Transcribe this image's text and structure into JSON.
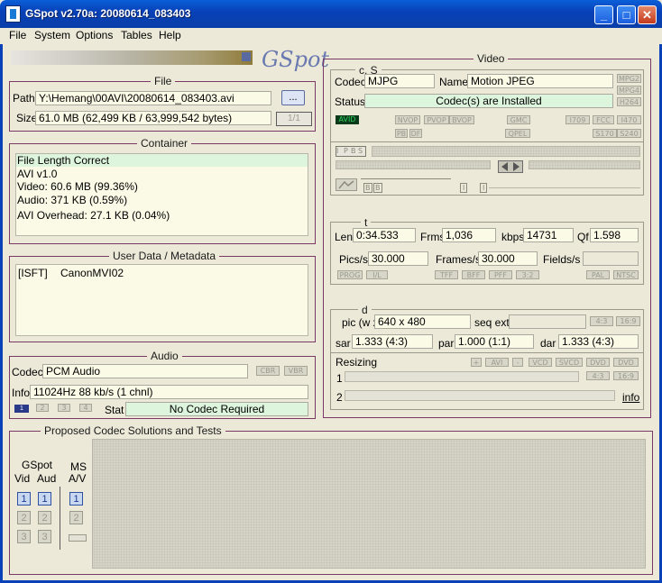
{
  "window": {
    "title": "GSpot v2.70a: 20080614_083403"
  },
  "menu": [
    "File",
    "System",
    "Options",
    "Tables",
    "Help"
  ],
  "logo_text": "GSpot",
  "file": {
    "title": "File",
    "path_label": "Path",
    "path_value": "Y:\\Hemang\\00AVI\\20080614_083403.avi",
    "browse_label": "...",
    "size_label": "Size",
    "size_value": "61.0 MB (62,499 KB / 63,999,542 bytes)",
    "page_counter": "1/1"
  },
  "container": {
    "title": "Container",
    "lines": [
      "File Length Correct",
      "AVI v1.0",
      "Video: 60.6 MB (99.36%)",
      "Audio: 371 KB (0.59%)",
      "AVI Overhead: 27.1 KB (0.04%)"
    ]
  },
  "metadata": {
    "title": "User Data / Metadata",
    "key": "[ISFT]",
    "value": "CanonMVI02"
  },
  "audio": {
    "title": "Audio",
    "codec_label": "Codec",
    "codec_value": "PCM Audio",
    "cbr": "CBR",
    "vbr": "VBR",
    "info_label": "Info",
    "info_value": "11024Hz  88 kb/s (1 chnl)",
    "stream_buttons": [
      "1",
      "2",
      "3",
      "4"
    ],
    "stat_label": "Stat",
    "stat_value": "No Codec Required"
  },
  "video": {
    "title": "Video",
    "cs_title": "c, S",
    "codec_label": "Codec",
    "codec_value": "MJPG",
    "name_label": "Name",
    "name_value": "Motion JPEG",
    "status_label": "Status",
    "status_value": "Codec(s) are Installed",
    "side_badges": [
      "MPG2",
      "MPG4",
      "H264"
    ],
    "avid": "AVID",
    "flags_row1": [
      "NVOP",
      "PVOP",
      "BVOP",
      "GMC",
      "I709",
      "FCC",
      "I470"
    ],
    "flags_row2": [
      "PB",
      "DF",
      "QPEL",
      "S170",
      "S240"
    ],
    "ipbs": [
      "I",
      "P",
      "B",
      "S"
    ],
    "bb": [
      "B",
      "B"
    ],
    "ii": [
      "I",
      "I"
    ],
    "t_title": "t",
    "len_label": "Len",
    "len_value": "0:34.533",
    "frms_label": "Frms",
    "frms_value": "1,036",
    "kbps_label": "kbps",
    "kbps_value": "14731",
    "qf_label": "Qf",
    "qf_value": "1.598",
    "pics_label": "Pics/s",
    "pics_value": "30.000",
    "frames_label": "Frames/s",
    "frames_value": "30.000",
    "fields_label": "Fields/s",
    "flags_row3": [
      "PROG",
      "I/L",
      "TFF",
      "BFF",
      "PFF",
      "3:2",
      "PAL",
      "NTSC"
    ],
    "d_title": "d",
    "pic_label": "pic (w x",
    "pic_value": "640 x 480",
    "seqext_label": "seq ext",
    "aspect_btns": [
      "4:3",
      "16:9"
    ],
    "sar_label": "sar",
    "sar_value": "1.333 (4:3)",
    "par_label": "par",
    "par_value": "1.000 (1:1)",
    "dar_label": "dar",
    "dar_value": "1.333 (4:3)",
    "resizing_label": "Resizing",
    "resize_btns": [
      "+",
      "AVI",
      "-",
      "VCD",
      "SVCD",
      "DVD",
      "DVD"
    ],
    "resize_aspect": [
      "4:3",
      "16:9"
    ],
    "row1": "1",
    "row2": "2",
    "info_link": "info"
  },
  "proposed": {
    "title": "Proposed Codec Solutions and Tests",
    "gspot_label": "GSpot",
    "vid_label": "Vid",
    "aud_label": "Aud",
    "ms_label": "MS",
    "av_label": "A/V",
    "nums": [
      "1",
      "2",
      "3"
    ]
  },
  "colors": {
    "titlebar": "#0a5fd8",
    "accent_border": "#7b3a66",
    "installed_green": "#ddf5dd"
  }
}
